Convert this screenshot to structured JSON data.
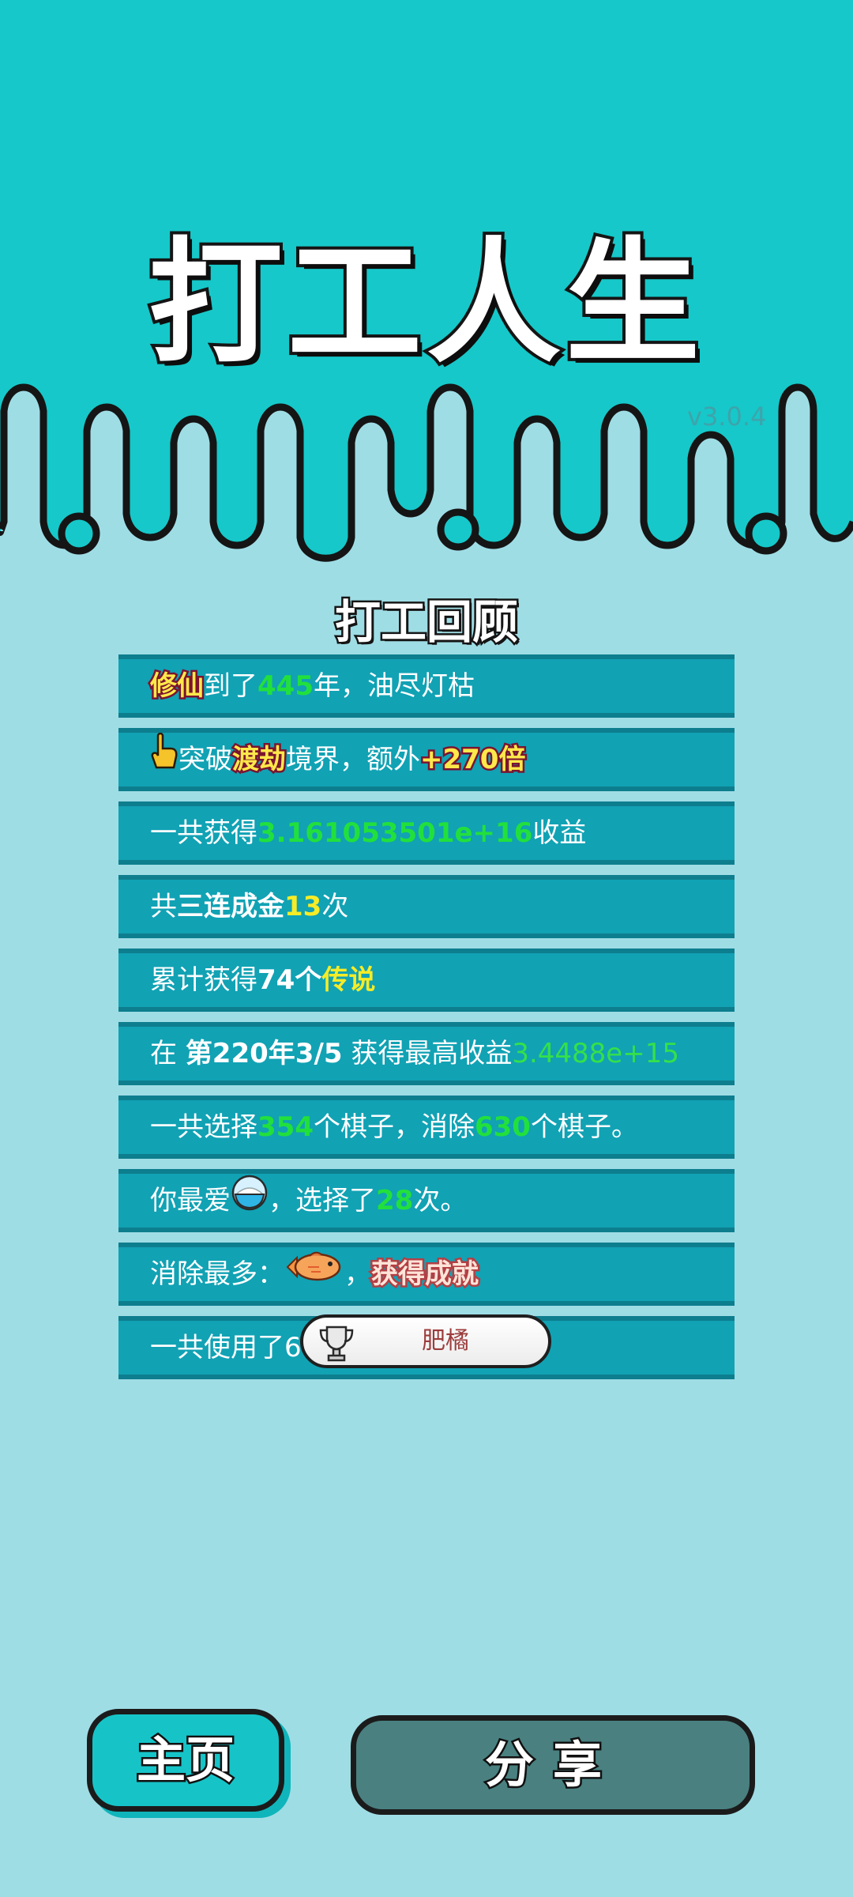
{
  "header": {
    "game_title": "打工人生",
    "version": "v3.0.4",
    "colors": {
      "sky": "#16c8c9",
      "panel": "#9fdde5"
    }
  },
  "review": {
    "title": "打工回顾",
    "rows": [
      {
        "realm": "修仙",
        "mid": "到了",
        "years": "445",
        "tail": "年，油尽灯枯"
      },
      {
        "icon": "pointing-hand-icon",
        "pre": "突破",
        "stage": "渡劫",
        "mid": "境界，额外",
        "bonus": "+270倍"
      },
      {
        "pre": "一共获得",
        "value": "3.161053501e+16",
        "tail": "收益"
      },
      {
        "pre": "共",
        "combo": "三连成金",
        "count": "13",
        "tail": "次"
      },
      {
        "pre": "累计获得",
        "count": "74个",
        "grade": "传说"
      },
      {
        "pre": "在 ",
        "date": "第220年3/5",
        "mid": " 获得最高收益",
        "value": "3.4488e+15"
      },
      {
        "pre": "一共选择",
        "chosen": "354",
        "mid": "个棋子，消除",
        "removed": "630",
        "tail": "个棋子。"
      },
      {
        "pre": "你最爱",
        "icon": "rice-bowl-icon",
        "mid": "，选择了",
        "count": "28",
        "tail": "次。"
      },
      {
        "pre": "消除最多：",
        "icon": "fish-icon",
        "mid": "，",
        "achievement": "获得成就"
      },
      {
        "pre": "一共使用了6"
      }
    ]
  },
  "toast": {
    "icon": "trophy-icon",
    "text": "肥橘"
  },
  "buttons": {
    "home": "主页",
    "share": "分享"
  }
}
